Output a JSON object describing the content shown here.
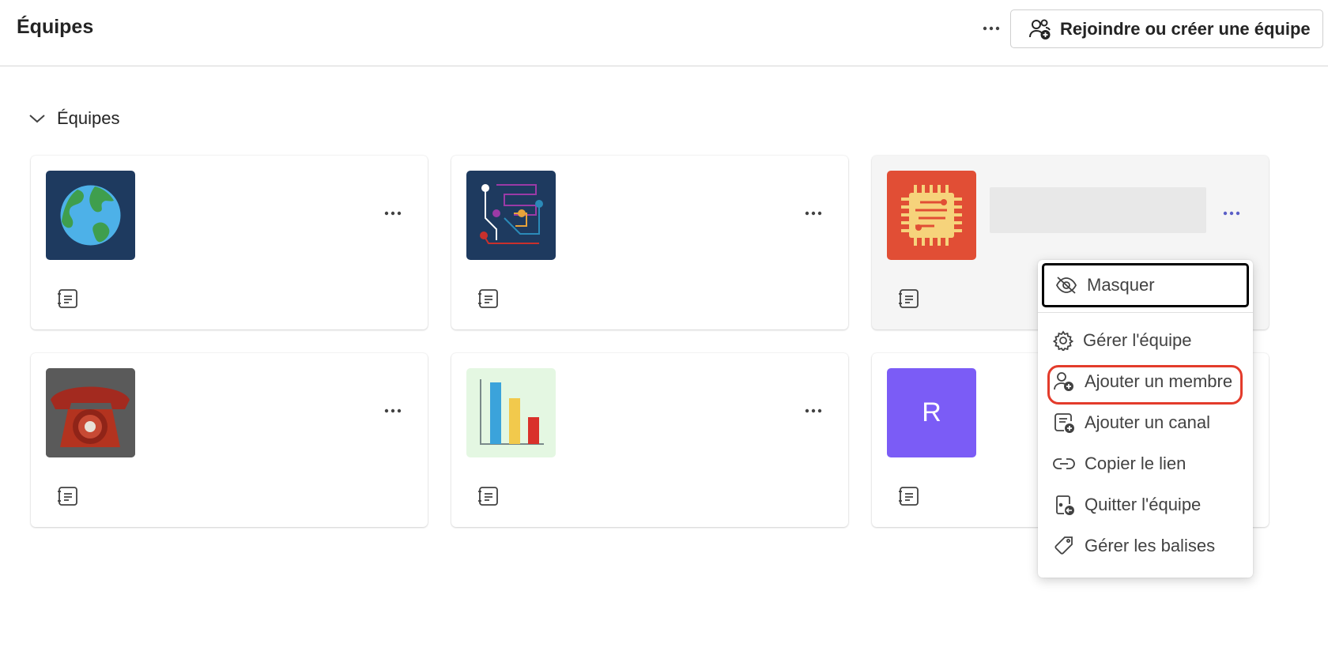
{
  "header": {
    "title": "Équipes",
    "more_icon": "more-horizontal-icon",
    "join_button_label": "Rejoindre ou créer une équipe",
    "join_button_icon": "people-add-icon"
  },
  "section": {
    "label": "Équipes",
    "expanded": true,
    "chevron_icon": "chevron-down-icon"
  },
  "teams": [
    {
      "avatar": "globe-image",
      "more_icon": "more-horizontal-icon",
      "channel_icon": "channel-list-icon"
    },
    {
      "avatar": "circuit-board-image",
      "more_icon": "more-horizontal-icon",
      "channel_icon": "channel-list-icon"
    },
    {
      "avatar": "chip-image",
      "more_icon": "more-horizontal-icon",
      "channel_icon": "channel-list-icon",
      "active": true
    },
    {
      "avatar": "red-telephone-photo",
      "more_icon": "more-horizontal-icon",
      "channel_icon": "channel-list-icon"
    },
    {
      "avatar": "bar-chart-image",
      "more_icon": "more-horizontal-icon",
      "channel_icon": "channel-list-icon"
    },
    {
      "avatar_letter": "R",
      "avatar_color": "#7b5cf6",
      "channel_icon": "channel-list-icon"
    }
  ],
  "context_menu": {
    "items": [
      {
        "label": "Masquer",
        "icon": "eye-off-icon",
        "focused": true
      },
      {
        "label": "Gérer l'équipe",
        "icon": "gear-icon"
      },
      {
        "label": "Ajouter un membre",
        "icon": "person-add-icon",
        "highlighted": true
      },
      {
        "label": "Ajouter un canal",
        "icon": "channel-add-icon"
      },
      {
        "label": "Copier le lien",
        "icon": "link-icon"
      },
      {
        "label": "Quitter l'équipe",
        "icon": "leave-icon"
      },
      {
        "label": "Gérer les balises",
        "icon": "tag-icon"
      }
    ]
  },
  "colors": {
    "accent_more": "#5b5fc7",
    "highlight_ring": "#e33b2b",
    "focus_ring": "#000000",
    "avatar_purple": "#7b5cf6"
  }
}
